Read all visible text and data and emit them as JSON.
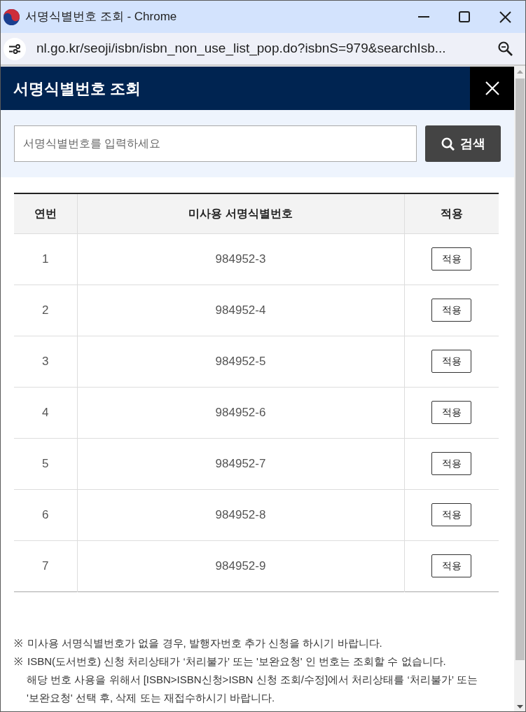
{
  "window": {
    "title": "서명식별번호 조회 - Chrome"
  },
  "address_bar": {
    "url": "nl.go.kr/seoji/isbn/isbn_non_use_list_pop.do?isbnS=979&searchIsb..."
  },
  "popup": {
    "title": "서명식별번호 조회"
  },
  "search": {
    "placeholder": "서명식별번호를 입력하세요",
    "button": "검색"
  },
  "table": {
    "columns": [
      "연번",
      "미사용 서명식별번호",
      "적용"
    ],
    "rows": [
      {
        "serial": "1",
        "identifier": "984952-3",
        "action": "적용"
      },
      {
        "serial": "2",
        "identifier": "984952-4",
        "action": "적용"
      },
      {
        "serial": "3",
        "identifier": "984952-5",
        "action": "적용"
      },
      {
        "serial": "4",
        "identifier": "984952-6",
        "action": "적용"
      },
      {
        "serial": "5",
        "identifier": "984952-7",
        "action": "적용"
      },
      {
        "serial": "6",
        "identifier": "984952-8",
        "action": "적용"
      },
      {
        "serial": "7",
        "identifier": "984952-9",
        "action": "적용"
      }
    ]
  },
  "notes": [
    {
      "mark": "※",
      "lines": [
        "미사용 서명식별번호가 없을 경우, 발행자번호 추가 신청을 하시기 바랍니다."
      ]
    },
    {
      "mark": "※",
      "lines": [
        "ISBN(도서번호) 신청 처리상태가 ‘처리불가’ 또는 '보완요청' 인 번호는 조회할 수 없습니다.",
        "해당 번호 사용을 위해서 [ISBN>ISBN신청>ISBN 신청 조회/수정]에서 처리상태를 ‘처리불가’ 또는 '보완요청' 선택 후, 삭제 또는 재접수하시기 바랍니다."
      ]
    }
  ]
}
